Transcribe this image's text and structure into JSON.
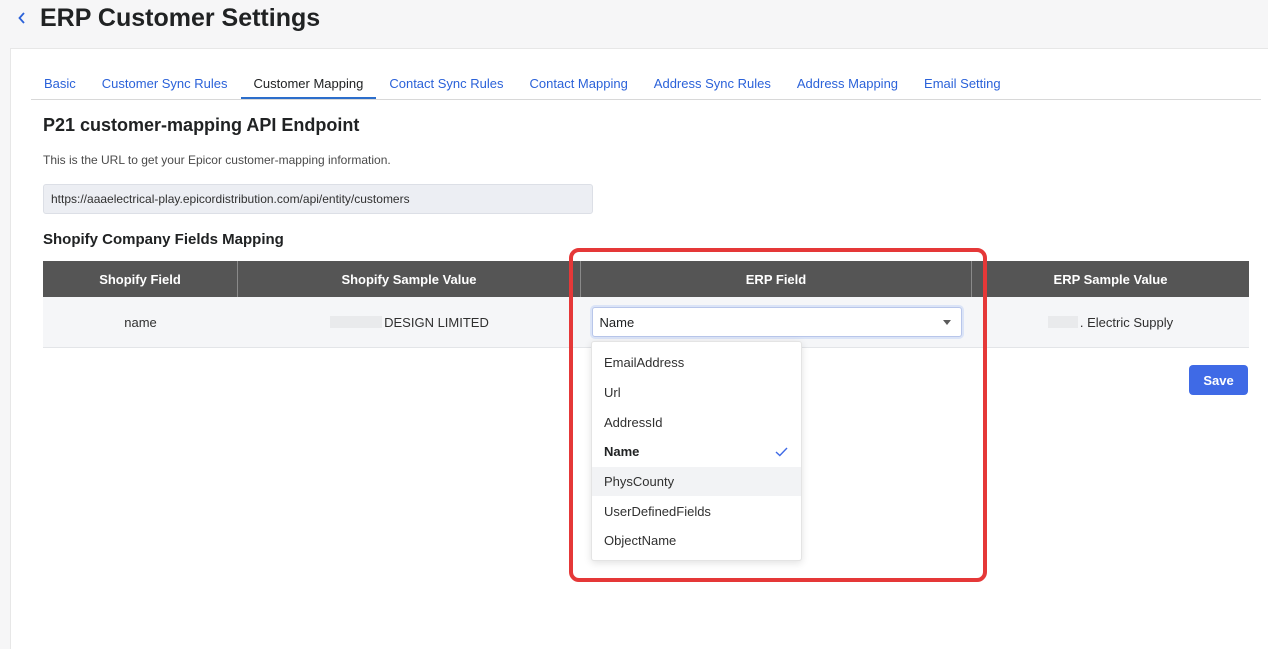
{
  "header": {
    "title": "ERP Customer Settings"
  },
  "tabs": [
    {
      "label": "Basic",
      "active": false
    },
    {
      "label": "Customer Sync Rules",
      "active": false
    },
    {
      "label": "Customer Mapping",
      "active": true
    },
    {
      "label": "Contact Sync Rules",
      "active": false
    },
    {
      "label": "Contact Mapping",
      "active": false
    },
    {
      "label": "Address Sync Rules",
      "active": false
    },
    {
      "label": "Address Mapping",
      "active": false
    },
    {
      "label": "Email Setting",
      "active": false
    }
  ],
  "endpoint": {
    "title": "P21 customer-mapping API Endpoint",
    "description": "This is the URL to get your Epicor customer-mapping information.",
    "url": "https://aaaelectrical-play.epicordistribution.com/api/entity/customers"
  },
  "mapping": {
    "title": "Shopify Company Fields Mapping",
    "columns": [
      "Shopify Field",
      "Shopify Sample Value",
      "ERP Field",
      "ERP Sample Value"
    ],
    "rows": [
      {
        "shopify_field": "name",
        "shopify_sample": "DESIGN LIMITED",
        "erp_field": "Name",
        "erp_sample": ". Electric Supply"
      }
    ]
  },
  "dropdown": {
    "options": [
      "EmailAddress",
      "Url",
      "AddressId",
      "Name",
      "PhysCounty",
      "UserDefinedFields",
      "ObjectName"
    ],
    "selected": "Name",
    "hovered": "PhysCounty"
  },
  "actions": {
    "save_label": "Save"
  },
  "colors": {
    "accent": "#3f6ae6",
    "link": "#2b62d9",
    "header_bg": "#555555",
    "highlight": "#e53838"
  },
  "icons": {
    "back": "chevron-left-icon",
    "caret": "caret-down-icon",
    "check": "check-icon"
  }
}
